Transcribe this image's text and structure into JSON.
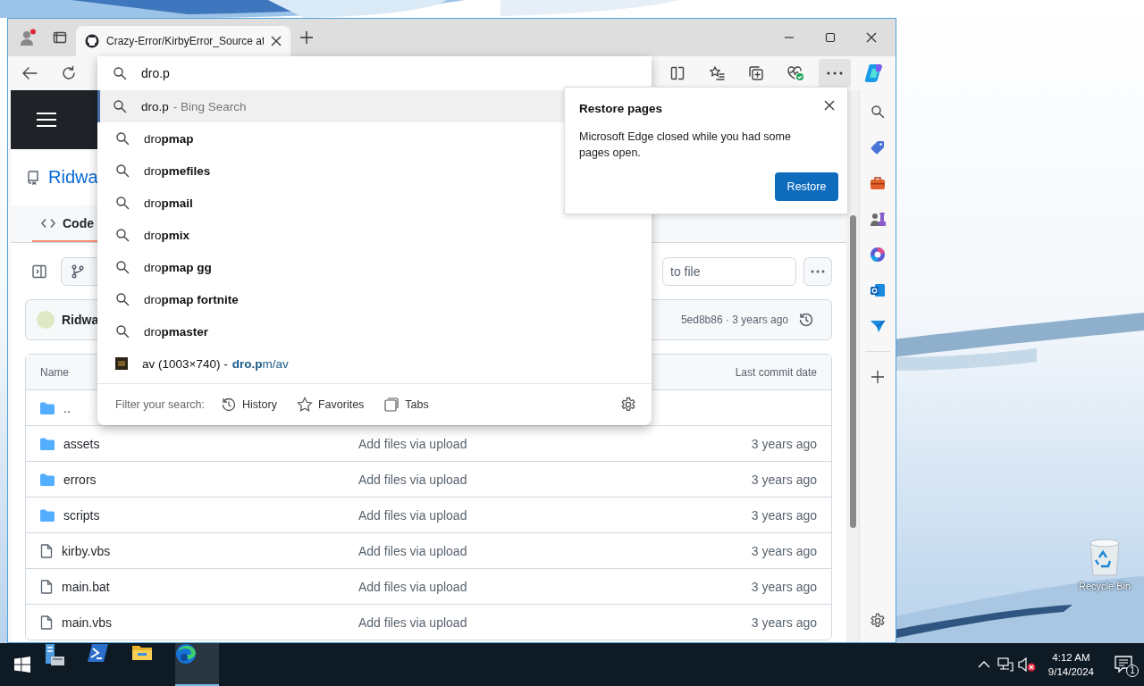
{
  "browser": {
    "tabs": [
      {
        "title": "Crazy-Error/KirbyError_Source at",
        "selected": true
      }
    ],
    "address_bar": {
      "value": "dro.p"
    },
    "suggestions": [
      {
        "kind": "search",
        "text": "dro.p",
        "detail": "- Bing Search",
        "selected": true
      },
      {
        "kind": "search",
        "text": "dro**pmap**",
        "selected": false
      },
      {
        "kind": "search",
        "text": "dro**pmefiles**",
        "selected": false
      },
      {
        "kind": "search",
        "text": "dro**pmail**",
        "selected": false
      },
      {
        "kind": "search",
        "text": "dro**pmix**",
        "selected": false
      },
      {
        "kind": "search",
        "text": "dro**pmap gg**",
        "selected": false
      },
      {
        "kind": "search",
        "text": "dro**pmap fortnite**",
        "selected": false
      },
      {
        "kind": "search",
        "text": "dro**pmaster**",
        "selected": false
      },
      {
        "kind": "site",
        "text": "av (1003×740) -",
        "url": "**dro.p**m/av",
        "selected": false
      }
    ],
    "filter": {
      "label": "Filter your search:",
      "options": [
        {
          "kind": "history",
          "label": "History"
        },
        {
          "kind": "favorites",
          "label": "Favorites"
        },
        {
          "kind": "tabs",
          "label": "Tabs"
        }
      ]
    },
    "restore_popup": {
      "title": "Restore pages",
      "message": "Microsoft Edge closed while you had some pages open.",
      "button": "Restore"
    },
    "page": {
      "repo": "Ridwa",
      "tabs": [
        {
          "label": "Code",
          "selected": true
        }
      ],
      "file_search": {
        "placeholder": "to file"
      },
      "commit": {
        "author": "Ridwa",
        "info": "5ed8b86 · 3 years ago"
      },
      "table": {
        "columns": [
          "Name",
          "Last commit date"
        ],
        "rows": [
          {
            "kind": "folder",
            "name": ".."
          },
          {
            "kind": "folder",
            "name": "assets",
            "message": "Add files via upload",
            "date": "3 years ago"
          },
          {
            "kind": "folder",
            "name": "errors",
            "message": "Add files via upload",
            "date": "3 years ago"
          },
          {
            "kind": "folder",
            "name": "scripts",
            "message": "Add files via upload",
            "date": "3 years ago"
          },
          {
            "kind": "file",
            "name": "kirby.vbs",
            "message": "Add files via upload",
            "date": "3 years ago"
          },
          {
            "kind": "file",
            "name": "main.bat",
            "message": "Add files via upload",
            "date": "3 years ago"
          },
          {
            "kind": "file",
            "name": "main.vbs",
            "message": "Add files via upload",
            "date": "3 years ago"
          }
        ]
      }
    }
  },
  "desktop": {
    "icons": [
      {
        "label": "Recycle Bin"
      }
    ]
  },
  "taskbar": {
    "apps": [
      {
        "kind": "server",
        "selected": false
      },
      {
        "kind": "powershell",
        "selected": false
      },
      {
        "kind": "explorer",
        "selected": false
      },
      {
        "kind": "edge",
        "selected": true
      }
    ],
    "clock": {
      "time": "4:12 AM",
      "date": "9/14/2024"
    },
    "notifications": "1"
  }
}
